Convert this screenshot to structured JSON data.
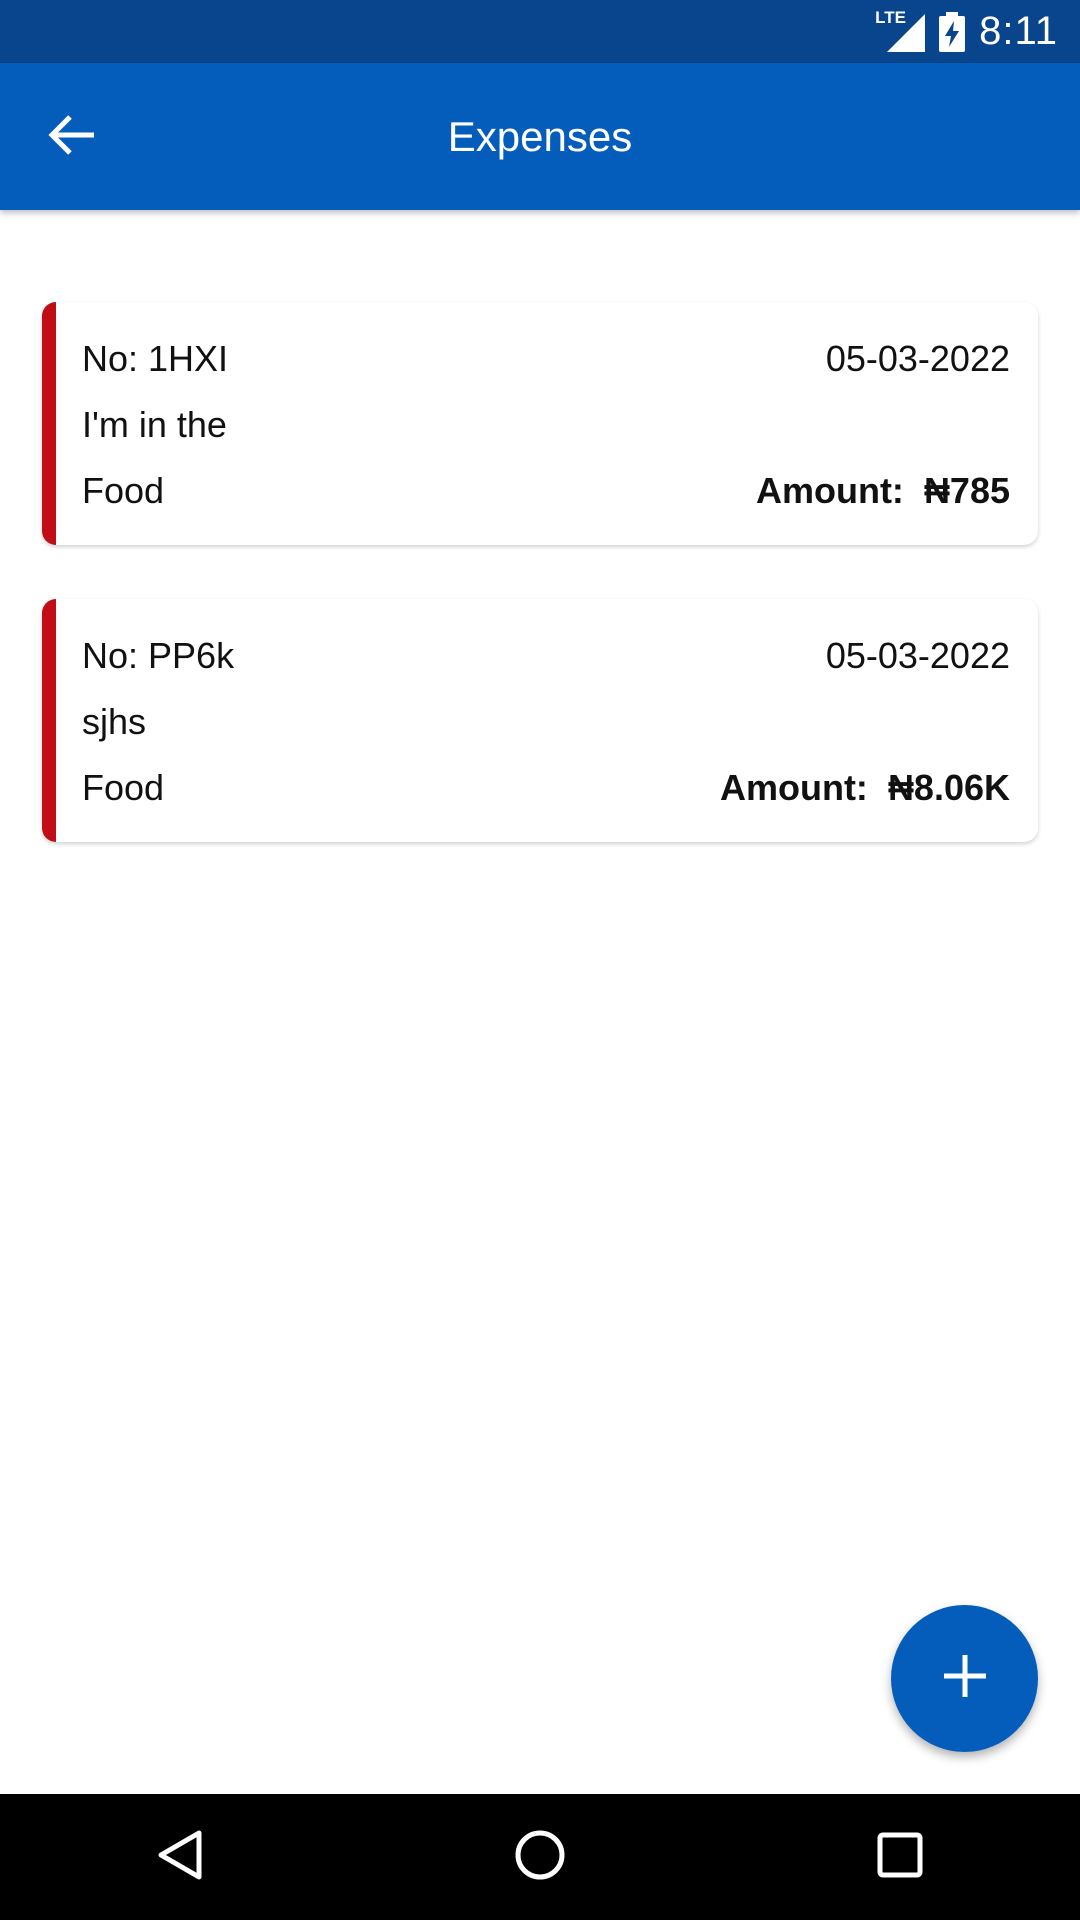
{
  "status_bar": {
    "network": "LTE",
    "time": "8:11",
    "icons": [
      "lte-signal-icon",
      "battery-charging-icon"
    ]
  },
  "app_bar": {
    "title": "Expenses",
    "back_icon": "arrow-back-icon"
  },
  "expenses": [
    {
      "number": "No: 1HXI",
      "date": "05-03-2022",
      "description": "I'm in the",
      "category": "Food",
      "amount_label": "Amount:",
      "amount": "₦785"
    },
    {
      "number": "No: PP6k",
      "date": "05-03-2022",
      "description": "sjhs",
      "category": "Food",
      "amount_label": "Amount:",
      "amount": "₦8.06K"
    }
  ],
  "fab": {
    "icon": "plus-icon"
  },
  "nav_bar": {
    "icons": [
      "back-triangle-icon",
      "home-circle-icon",
      "recents-square-icon"
    ]
  },
  "colors": {
    "primary": "#045dbb",
    "status_bar": "#08458c",
    "card_accent": "#c00d16"
  }
}
